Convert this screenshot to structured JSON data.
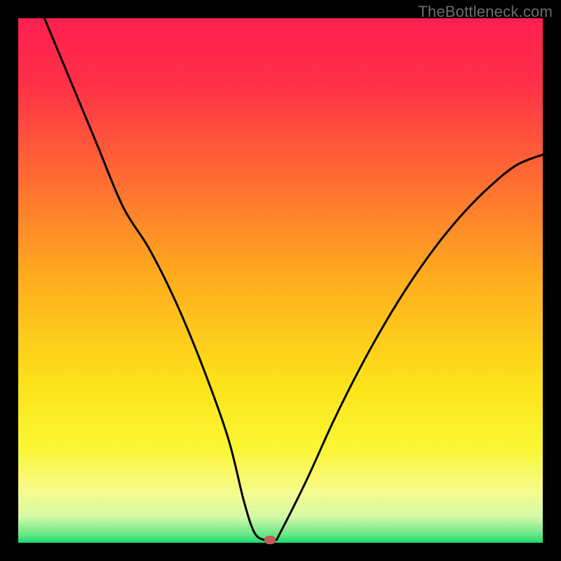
{
  "watermark": "TheBottleneck.com",
  "colors": {
    "frame": "#000000",
    "curve": "#000000",
    "marker": "#c45a54",
    "gradient_stops": [
      {
        "offset": 0.0,
        "color": "#ff1f4f"
      },
      {
        "offset": 0.12,
        "color": "#ff2f48"
      },
      {
        "offset": 0.3,
        "color": "#fe6a33"
      },
      {
        "offset": 0.5,
        "color": "#ffae1e"
      },
      {
        "offset": 0.7,
        "color": "#fce31a"
      },
      {
        "offset": 0.82,
        "color": "#fbf634"
      },
      {
        "offset": 0.9,
        "color": "#f7fb8a"
      },
      {
        "offset": 0.95,
        "color": "#d6f9a8"
      },
      {
        "offset": 0.985,
        "color": "#64e787"
      },
      {
        "offset": 1.0,
        "color": "#18db6f"
      }
    ]
  },
  "chart_data": {
    "type": "line",
    "title": "",
    "xlabel": "",
    "ylabel": "",
    "xlim": [
      0,
      100
    ],
    "ylim": [
      0,
      100
    ],
    "grid": false,
    "series": [
      {
        "name": "bottleneck-curve",
        "x": [
          5,
          10,
          15,
          20,
          25,
          30,
          35,
          40,
          43,
          45,
          47,
          49,
          50,
          55,
          60,
          65,
          70,
          75,
          80,
          85,
          90,
          95,
          100
        ],
        "y": [
          100,
          88,
          76,
          64,
          56,
          46,
          34,
          20,
          8,
          2,
          0.5,
          0.5,
          2,
          12,
          23,
          33,
          42,
          50,
          57,
          63,
          68,
          72,
          74
        ]
      }
    ],
    "annotations": [
      {
        "name": "minimum-marker",
        "x": 48,
        "y": 0.5
      }
    ]
  }
}
